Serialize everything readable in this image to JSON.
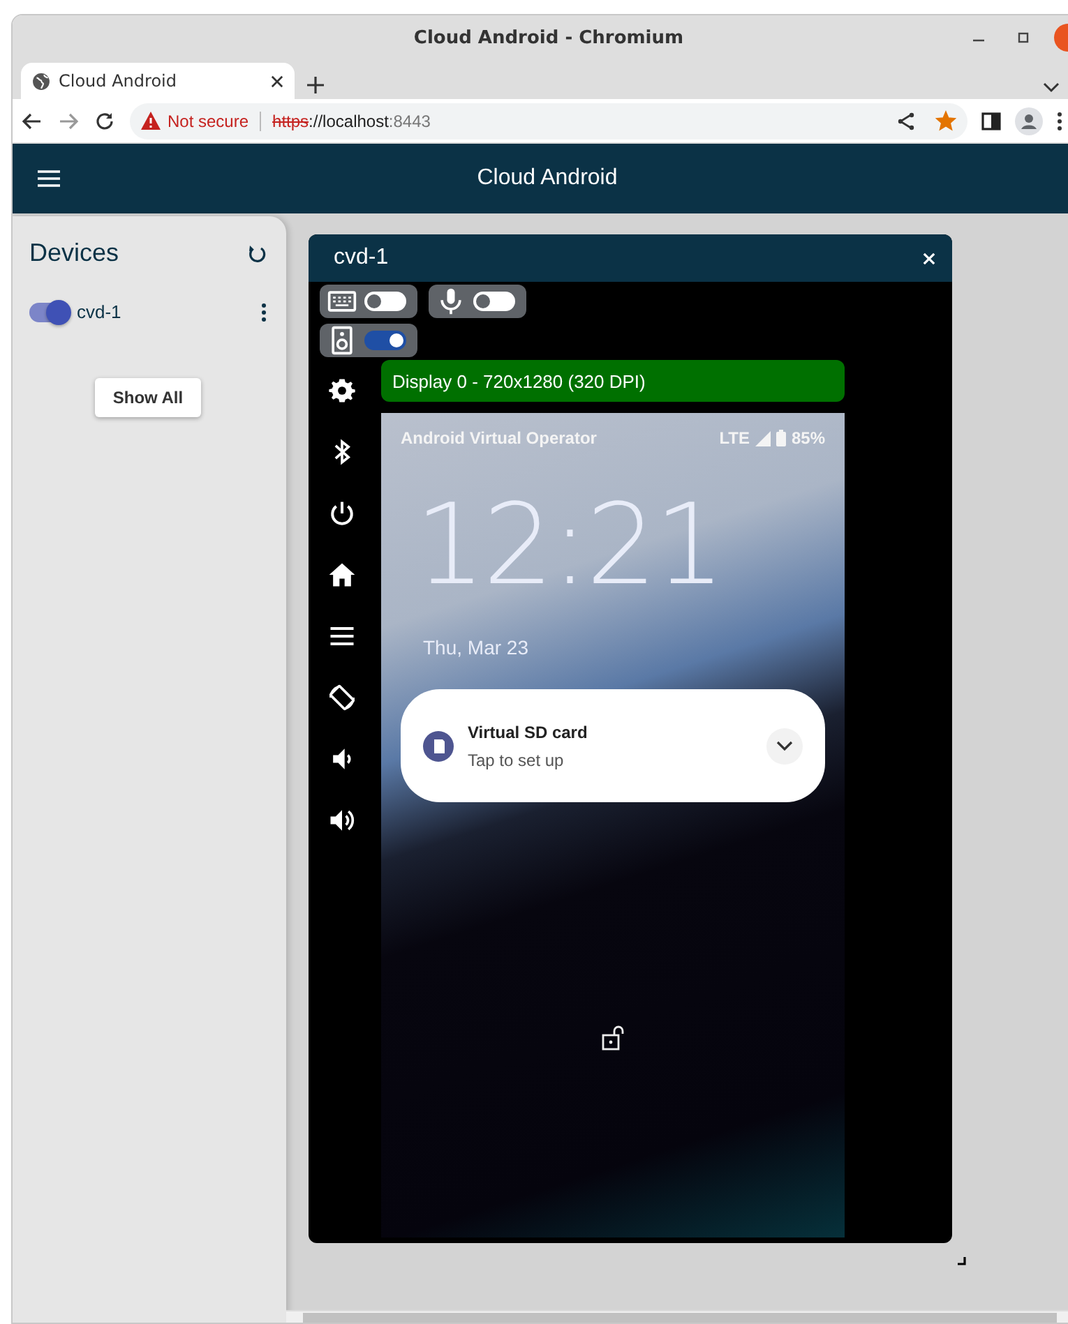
{
  "window": {
    "title": "Cloud Android - Chromium"
  },
  "tabs": [
    {
      "label": "Cloud Android",
      "selected": true
    }
  ],
  "address_bar": {
    "security_label": "Not secure",
    "scheme": "https",
    "host": "://localhost",
    "port": ":8443",
    "bookmarked": true
  },
  "app_bar": {
    "title": "Cloud Android"
  },
  "sidebar": {
    "title": "Devices",
    "devices": [
      {
        "name": "cvd-1",
        "on": true
      }
    ],
    "show_all_button": "Show All"
  },
  "device_panel": {
    "title": "cvd-1",
    "toggles": [
      {
        "kind": "keyboard",
        "on": false
      },
      {
        "kind": "microphone",
        "on": false
      },
      {
        "kind": "speaker",
        "on": true
      }
    ],
    "controls": [
      {
        "kind": "settings"
      },
      {
        "kind": "bluetooth"
      },
      {
        "kind": "power"
      },
      {
        "kind": "home"
      },
      {
        "kind": "menu"
      },
      {
        "kind": "rotate"
      },
      {
        "kind": "volume_down"
      },
      {
        "kind": "volume_up"
      }
    ],
    "display_label": "Display 0 - 720x1280 (320 DPI)",
    "lock_screen": {
      "carrier": "Android Virtual Operator",
      "network": "LTE",
      "battery": "85%",
      "time": "12:21",
      "date": "Thu, Mar 23",
      "notification": {
        "title": "Virtual SD card",
        "text": "Tap to set up",
        "expanded": false
      }
    }
  }
}
